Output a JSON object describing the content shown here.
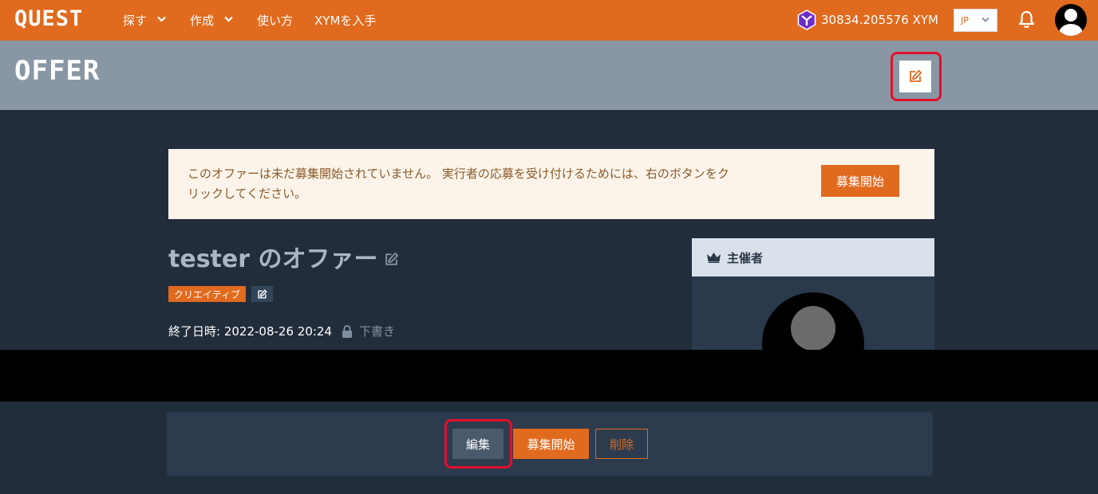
{
  "topbar": {
    "logo": "QUEST",
    "nav": [
      {
        "label": "探す",
        "has_dropdown": true
      },
      {
        "label": "作成",
        "has_dropdown": true
      },
      {
        "label": "使い方",
        "has_dropdown": false
      },
      {
        "label": "XYMを入手",
        "has_dropdown": false
      }
    ],
    "balance": "30834.205576 XYM",
    "balance_icon": "symbol-logo-icon",
    "language": "JP",
    "icons": [
      "chevron-down-icon",
      "bell-icon",
      "avatar"
    ]
  },
  "header": {
    "title": "OFFER",
    "edit_icon": "edit-icon"
  },
  "notice": {
    "text": "このオファーは未だ募集開始されていません。 実行者の応募を受け付けるためには、右のボタンをクリックしてください。",
    "button": "募集開始"
  },
  "offer": {
    "title": "tester のオファー",
    "category": "クリエイティブ",
    "end_date_label": "終了日時:",
    "end_date": "2022-08-26 20:24",
    "status": "下書き",
    "status_icon": "lock-icon"
  },
  "host": {
    "heading": "主催者",
    "heading_icon": "crown-icon"
  },
  "actions": {
    "edit": "編集",
    "start": "募集開始",
    "delete": "削除"
  },
  "colors": {
    "brand": "#e06a1e",
    "header_band": "#8996a4",
    "page_bg": "#222d3b",
    "highlight": "#e3102b"
  }
}
